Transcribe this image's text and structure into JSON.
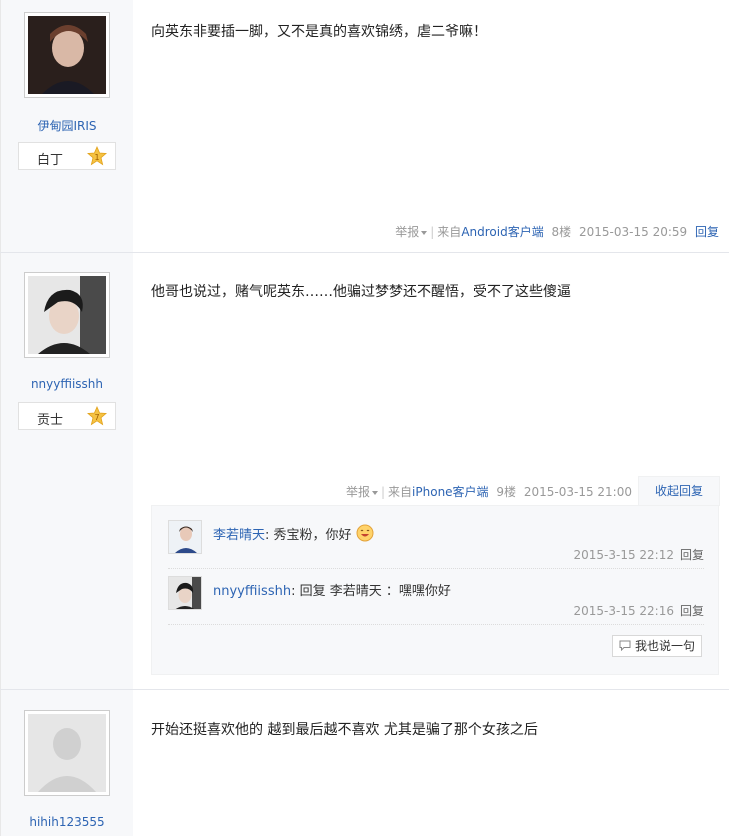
{
  "posts": [
    {
      "username": "伊甸园IRIS",
      "level_name": "白丁",
      "level_num": "1",
      "content": "向英东非要插一脚，又不是真的喜欢锦绣，虐二爷嘛！",
      "report": "举报",
      "source_prefix": "来自",
      "source_client": "Android客户端",
      "floor": "8楼",
      "time": "2015-03-15 20:59",
      "reply": "回复"
    },
    {
      "username": "nnyyffiisshh",
      "level_name": "贡士",
      "level_num": "7",
      "content": "他哥也说过，赌气呢英东……他骗过梦梦还不醒悟，受不了这些傻逼",
      "report": "举报",
      "source_prefix": "来自",
      "source_client": "iPhone客户端",
      "floor": "9楼",
      "time": "2015-03-15 21:00",
      "collapse": "收起回复",
      "sub_replies": [
        {
          "user": "李若晴天",
          "text": "秀宝粉，你好",
          "time": "2015-3-15 22:12",
          "reply": "回复"
        },
        {
          "user": "nnyyffiisshh",
          "text": "回复 李若晴天 ：嘿嘿你好",
          "time": "2015-3-15 22:16",
          "reply": "回复"
        }
      ],
      "say_button": "我也说一句"
    },
    {
      "username": "hihih123555",
      "content": "开始还挺喜欢他的 越到最后越不喜欢 尤其是骗了那个女孩之后"
    }
  ]
}
